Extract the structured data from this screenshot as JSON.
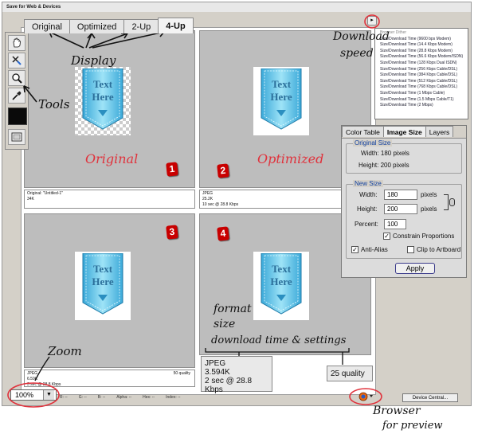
{
  "window": {
    "title": "Save for Web & Devices"
  },
  "tabs": [
    "Original",
    "Optimized",
    "2-Up",
    "4-Up"
  ],
  "active_tab": "4-Up",
  "preview": {
    "ribbon_text": "Text\nHere",
    "panes": [
      {
        "info": "Original: \"Untitled-1\"\n34K"
      },
      {
        "info": "JPEG\n25.2K\n10 sec @ 28.8 Kbps"
      },
      {
        "info": ""
      },
      {
        "info": "JPEG\n6.59K\n3 sec @ 28.8 Kbps",
        "right": "50 quality"
      }
    ]
  },
  "badges": [
    "1",
    "2",
    "3",
    "4"
  ],
  "download_menu": {
    "items": [
      "Browser Dither",
      "Size/Download Time (9600 bps Modem)",
      "Size/Download Time (14.4 Kbps Modem)",
      "Size/Download Time (28.8 Kbps Modem)",
      "Size/Download Time (56.6 Kbps Modem/ISDN)",
      "Size/Download Time (128 Kbps Dual ISDN)",
      "Size/Download Time (256 Kbps Cable/DSL)",
      "Size/Download Time (384 Kbps Cable/DSL)",
      "Size/Download Time (512 Kbps Cable/DSL)",
      "Size/Download Time (768 Kbps Cable/DSL)",
      "Size/Download Time (1 Mbps Cable)",
      "Size/Download Time (1.5 Mbps Cable/T1)",
      "Size/Download Time (2 Mbps)"
    ]
  },
  "panel": {
    "tabs": [
      "Color Table",
      "Image Size",
      "Layers"
    ],
    "active_tab": "Image Size",
    "original_size": {
      "label": "Original Size",
      "width": "Width: 180 pixels",
      "height": "Height: 200 pixels"
    },
    "new_size": {
      "label": "New Size",
      "width_label": "Width:",
      "width_value": "180",
      "width_unit": "pixels",
      "height_label": "Height:",
      "height_value": "200",
      "height_unit": "pixels",
      "percent_label": "Percent:",
      "percent_value": "100",
      "constrain": "Constrain Proportions",
      "anti_alias": "Anti-Alias",
      "clip": "Clip to Artboard",
      "apply": "Apply"
    }
  },
  "callout_jpeg": {
    "line1": "JPEG",
    "line2": "3.594K",
    "line3": "2 sec @ 28.8 Kbps"
  },
  "callout_quality": "25 quality",
  "status": {
    "zoom": "100%",
    "fields": [
      "R: --",
      "G: --",
      "B: --",
      "Alpha: --",
      "Hex: --",
      "Index: --"
    ],
    "device_central": "Device Central..."
  },
  "annotations": {
    "display": "Display",
    "tools": "Tools",
    "download": "Download",
    "speed": "speed",
    "original": "Original",
    "optimized": "Optimized",
    "format": "format",
    "size": "size",
    "download_time": "download time & settings",
    "zoom": "Zoom",
    "browser": "Browser",
    "for_preview": "for preview"
  },
  "colors": {
    "badge": "#c80000",
    "annotation_red": "#e0323c",
    "ribbon": "#59c4e8"
  }
}
